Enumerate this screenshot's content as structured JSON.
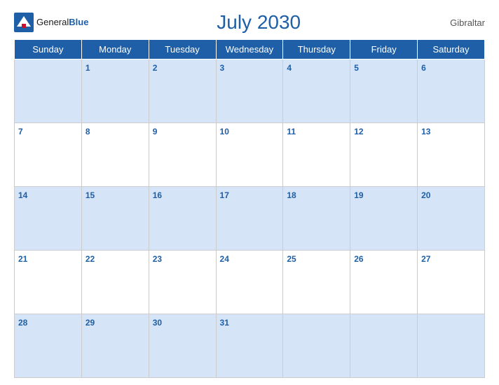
{
  "header": {
    "logo_general": "General",
    "logo_blue": "Blue",
    "title": "July 2030",
    "location": "Gibraltar"
  },
  "days_of_week": [
    "Sunday",
    "Monday",
    "Tuesday",
    "Wednesday",
    "Thursday",
    "Friday",
    "Saturday"
  ],
  "weeks": [
    [
      null,
      1,
      2,
      3,
      4,
      5,
      6
    ],
    [
      7,
      8,
      9,
      10,
      11,
      12,
      13
    ],
    [
      14,
      15,
      16,
      17,
      18,
      19,
      20
    ],
    [
      21,
      22,
      23,
      24,
      25,
      26,
      27
    ],
    [
      28,
      29,
      30,
      31,
      null,
      null,
      null
    ]
  ]
}
